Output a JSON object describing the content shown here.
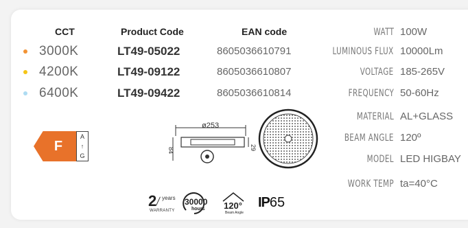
{
  "headers": {
    "cct": "CCT",
    "product_code": "Product Code",
    "ean_code": "EAN code"
  },
  "variants": [
    {
      "cct": "3000K",
      "code": "LT49-05022",
      "ean": "8605036610791",
      "dot_color": "#f29334"
    },
    {
      "cct": "4200K",
      "code": "LT49-09122",
      "ean": "8605036610807",
      "dot_color": "#f5c516"
    },
    {
      "cct": "6400K",
      "code": "LT49-09422",
      "ean": "8605036610814",
      "dot_color": "#aedcf2"
    }
  ],
  "specs": [
    {
      "label": "WATT",
      "value": "100W"
    },
    {
      "label": "LUMINOUS FLUX",
      "value": "10000Lm"
    },
    {
      "label": "VOLTAGE",
      "value": "185-265V"
    },
    {
      "label": "FREQUENCY",
      "value": "50-60Hz"
    },
    {
      "label": "MATERIAL",
      "value": "AL+GLASS"
    },
    {
      "label": "BEAM ANGLE",
      "value": "120º"
    },
    {
      "label": "MODEL",
      "value": "LED HIGBAY"
    },
    {
      "label": "WORK TEMP",
      "value": "ta=40°C"
    }
  ],
  "energy": {
    "class": "F",
    "scale_top": "A",
    "scale_arrow": "↑",
    "scale_bottom": "G"
  },
  "dimensions": {
    "diameter": "ø253",
    "height_side": "29",
    "height_left": "84"
  },
  "badges": {
    "warranty_number": "2",
    "warranty_unit": "years",
    "warranty_label": "WARRANTY",
    "hours_number": "30000",
    "hours_label": "hours",
    "beam_number": "120°",
    "beam_label": "Beam Angle",
    "ip_prefix": "IP",
    "ip_number": "65"
  },
  "colors": {
    "energy_f": "#e8722a"
  }
}
